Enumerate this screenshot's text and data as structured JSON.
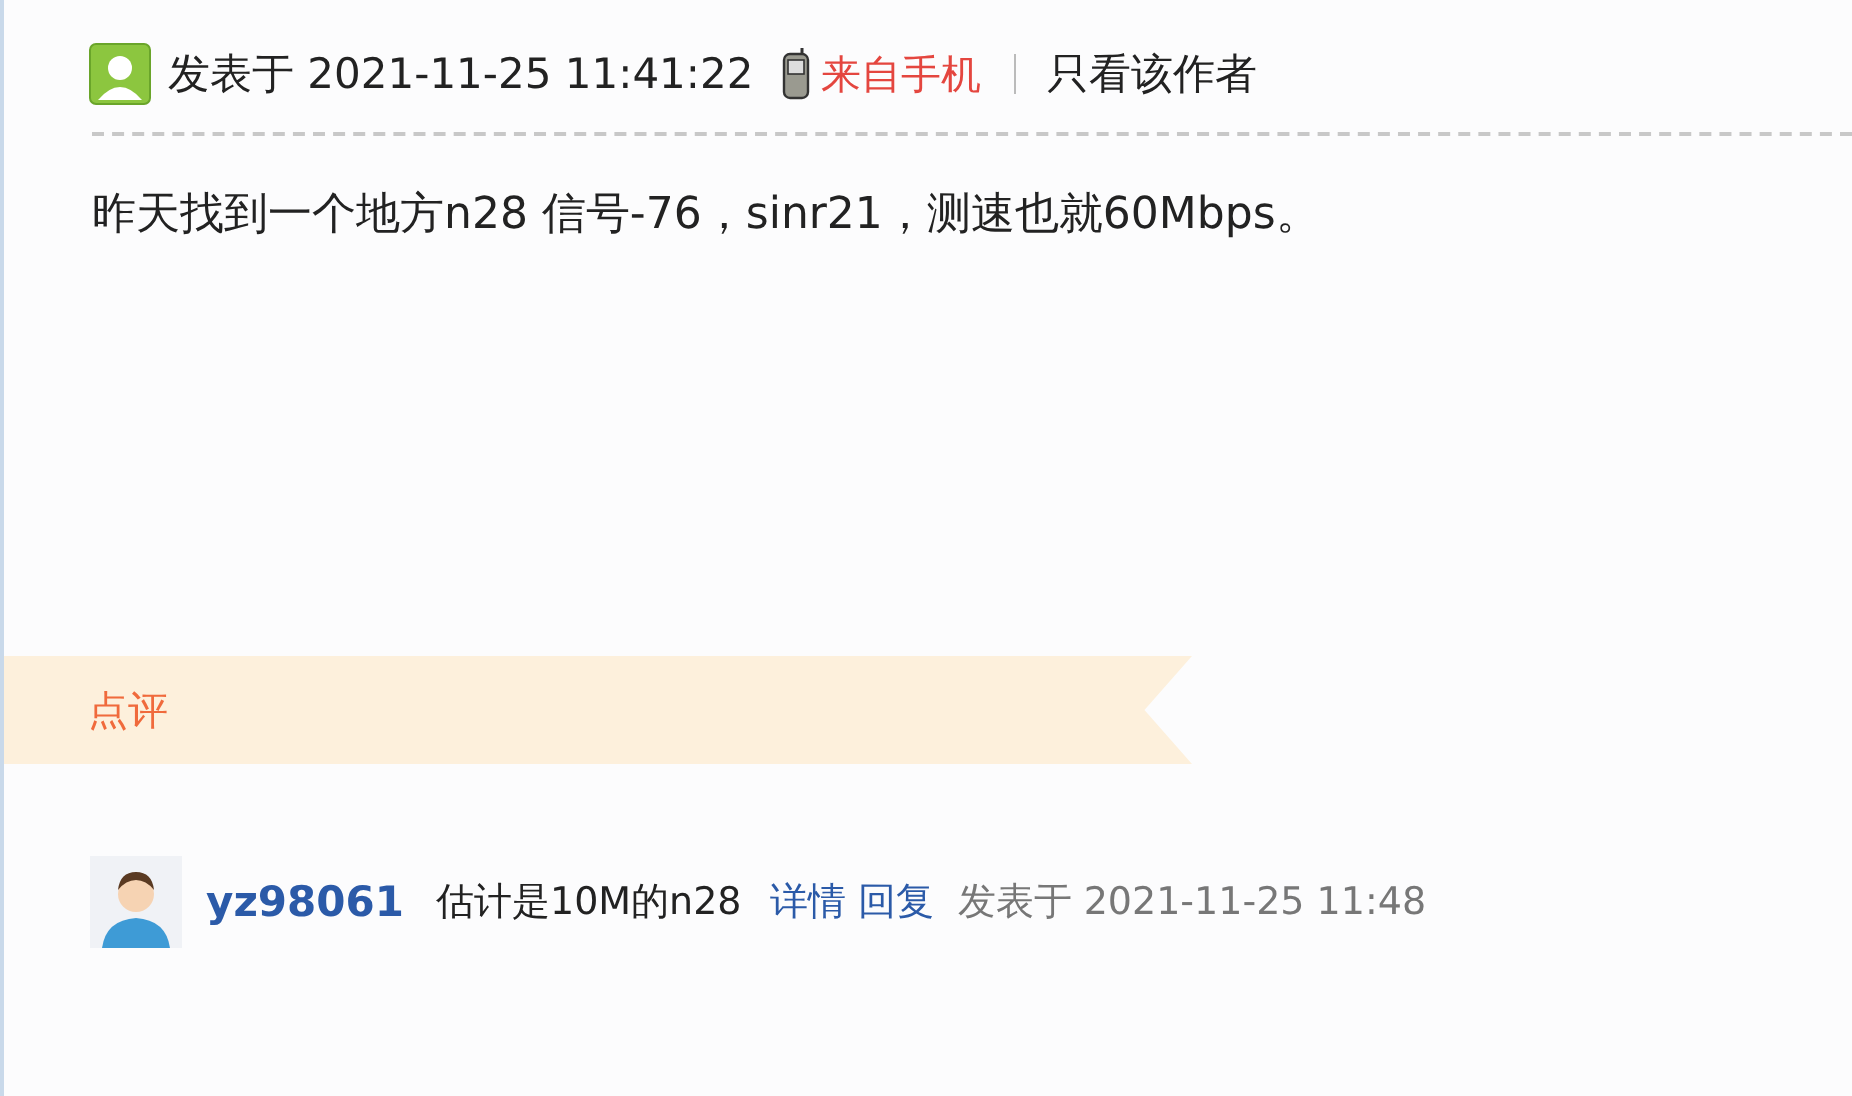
{
  "post_meta": {
    "posted_label": "发表于 2021-11-25 11:41:22",
    "source": "来自手机",
    "author_only_link": "只看该作者"
  },
  "post_body": "昨天找到一个地方n28 信号-76，sinr21，测速也就60Mbps。",
  "comments_section": {
    "title": "点评",
    "comments": [
      {
        "username": "yz98061",
        "text": "估计是10M的n28",
        "detail_link": "详情",
        "reply_link": "回复",
        "time": "发表于 2021-11-25 11:48"
      }
    ]
  }
}
